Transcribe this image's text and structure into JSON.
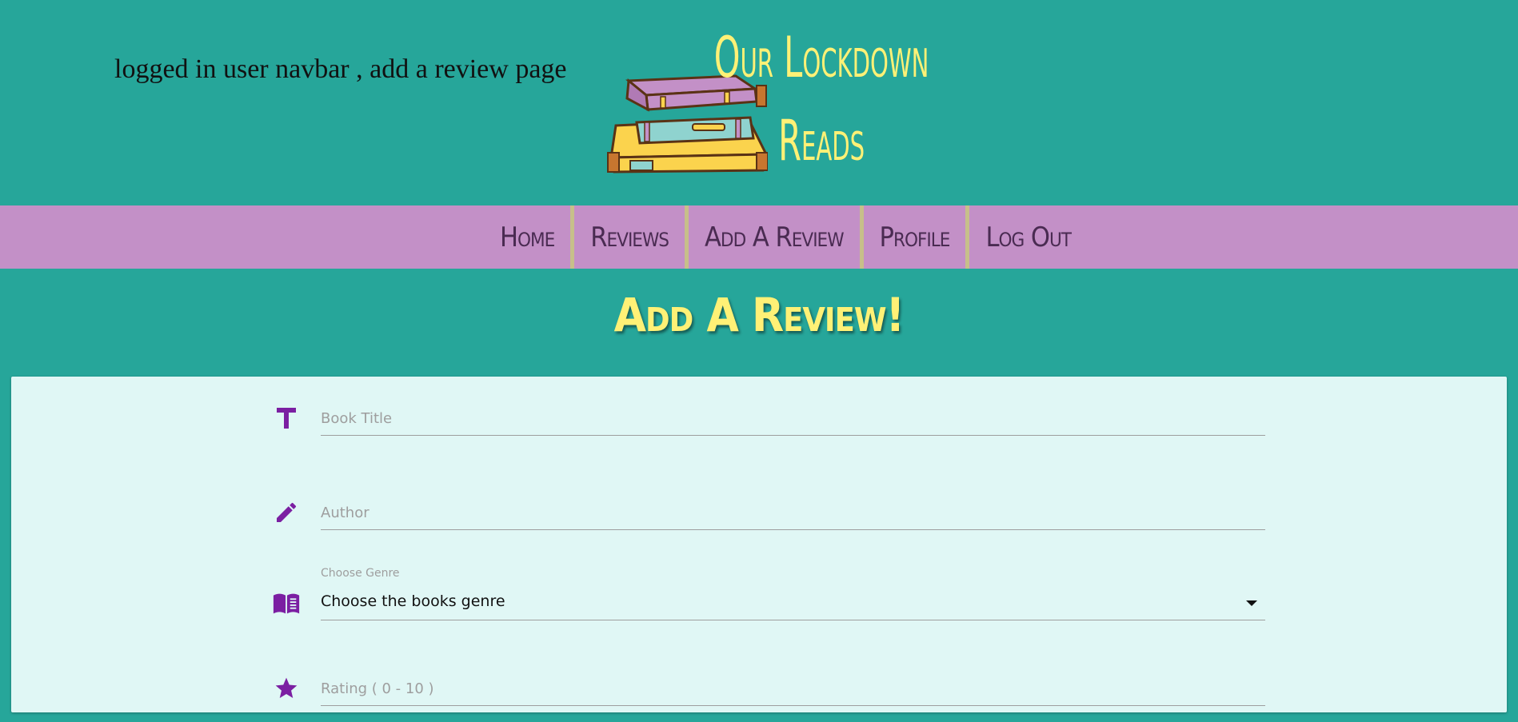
{
  "caption": "logged in user navbar , add a review page",
  "brand": {
    "line1": "Our Lockdown",
    "line2": "Reads",
    "logo_icon": "book-stack-icon"
  },
  "nav": {
    "items": [
      {
        "label": "Home"
      },
      {
        "label": "Reviews"
      },
      {
        "label": "Add A Review"
      },
      {
        "label": "Profile"
      },
      {
        "label": "Log Out"
      }
    ]
  },
  "page": {
    "heading": "Add A Review!"
  },
  "form": {
    "title": {
      "placeholder": "Book Title",
      "icon": "title-icon"
    },
    "author": {
      "placeholder": "Author",
      "icon": "pencil-icon"
    },
    "genre": {
      "label": "Choose Genre",
      "value": "Choose the books genre",
      "icon": "book-open-icon"
    },
    "rating": {
      "placeholder": "Rating ( 0 - 10 )",
      "icon": "star-icon"
    }
  },
  "colors": {
    "background": "#26a69a",
    "navbar": "#c390c7",
    "accent_yellow": "#fff176",
    "icon_purple": "#7b1fa2",
    "card": "#e0f7f5"
  }
}
